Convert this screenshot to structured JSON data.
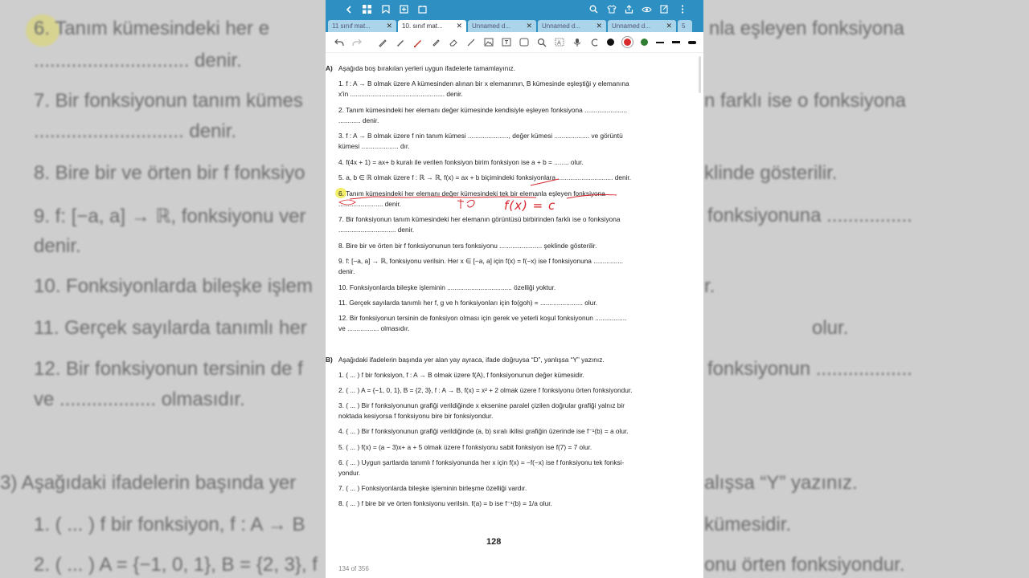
{
  "tabs": [
    {
      "label": "11 sınıf mat...",
      "active": false
    },
    {
      "label": "10. sınıf mat...",
      "active": true
    },
    {
      "label": "Unnamed d...",
      "active": false
    },
    {
      "label": "Unnamed d...",
      "active": false
    },
    {
      "label": "Unnamed d...",
      "active": false
    },
    {
      "label": "5",
      "active": false
    }
  ],
  "colors": {
    "topbar": "#2e8fc2",
    "ink": "#d6242b",
    "highlight": "#f3ee6a",
    "dot_red": "#d92c2c",
    "dot_green": "#2f7d32"
  },
  "handwriting": {
    "answer": "f(x) = c"
  },
  "sectionA": {
    "marker": "A)",
    "instruction": "Aşağıda boş bırakılan yerleri uygun ifadelerle tamamlayınız.",
    "lines": [
      "1. f : A → B olmak üzere A kümesinden alınan bir x elemanının, B kümesinde eşleştiği y elemanına",
      "x'in ................................................... denir.",
      "2. Tanım kümesindeki her elemanı değer kümesinde kendisiyle eşleyen fonksiyona .......................",
      "............ denir.",
      "3. f : A → B olmak üzere f nin tanım kümesi ......................, değer kümesi ................... ve görüntü",
      "kümesi .................... dır.",
      "4. f(4x + 1) = ax+ b kuralı ile verilen fonksiyon birim fonksiyon ise a + b = ........ olur.",
      "5. a, b ∈ ℝ olmak üzere f : ℝ → ℝ,  f(x) = ax + b biçimindeki fonksiyonlara .............................. denir.",
      "6. Tanım kümesindeki her elemanı değer kümesindeki tek bir elemanla eşleyen fonksiyona",
      "........................ denir.",
      "7. Bir fonksiyonun tanım kümesindeki her elemanın görüntüsü birbirinden farklı ise o fonksiyona",
      "............................... denir.",
      "8. Bire bir ve örten bir f fonksiyonunun ters fonksiyonu ....................... şeklinde gösterilir.",
      "9. f: [−a, a] → ℝ, fonksiyonu verilsin. Her x ∈ [−a, a] için f(x) = f(−x) ise f fonksiyonuna ................",
      "denir.",
      "10. Fonksiyonlarda bileşke işleminin ................................... özelliği yoktur.",
      "11. Gerçek sayılarda tanımlı her f, g ve h fonksiyonları için fo(goh) = ....................... olur.",
      "12. Bir fonksiyonun tersinin de fonksiyon olması için gerek ve yeterli koşul fonksiyonun .................",
      "ve ................. olmasıdır."
    ]
  },
  "sectionB": {
    "marker": "B)",
    "instruction": "Aşağıdaki ifadelerin başında yer alan yay ayraca, ifade doğruysa “D”, yanlışsa “Y” yazınız.",
    "lines": [
      "1. ( ... ) f bir fonksiyon, f : A → B olmak üzere f(A), f fonksiyonunun değer kümesidir.",
      "2. ( ... ) A = {−1, 0, 1}, B = {2, 3}, f : A → B, f(x) = x² + 2 olmak üzere f fonksiyonu örten fonksiyondur.",
      "3. ( ... ) Bir f fonksiyonunun grafiği verildiğinde x eksenine paralel çizilen doğrular grafiği yalnız bir",
      "noktada kesiyorsa f fonksiyonu bire bir fonksiyondur.",
      "4. ( ... ) Bir f fonksiyonunun grafiği verildiğinde (a, b) sıralı ikilisi grafiğin üzerinde ise f⁻¹(b) = a olur.",
      "5. ( ... ) f(x) = (a − 3)x+ a + 5 olmak üzere f fonksiyonu sabit fonksiyon ise f(7) = 7 olur.",
      "6. ( ... ) Uygun şartlarda tanımlı f fonksiyonunda her x için f(x) = −f(−x) ise f fonksiyonu tek fonksi-",
      "yondur.",
      "7. ( ... ) Fonksiyonlarda bileşke işleminin birleşme özelliği vardır.",
      "8. ( ... ) f bire bir ve örten fonksiyonu verilsin. f(a) = b ise f⁻¹(b) = 1/a olur."
    ]
  },
  "page_number": "128",
  "page_count": "134 of 356",
  "background": {
    "lines": [
      "6. Tanım kümesindeki her e",
      "............................. denir.",
      "7. Bir fonksiyonun tanım kümes",
      "............................ denir.",
      "8. Bire bir ve örten bir f fonksiyo",
      "9. f: [−a, a] → ℝ, fonksiyonu ver",
      "denir.",
      "10. Fonksiyonlarda bileşke işlem",
      "11. Gerçek sayılarda tanımlı her",
      "12. Bir fonksiyonun tersinin de f",
      "ve .................. olmasıdır.",
      "3)  Aşağıdaki ifadelerin başında yer",
      "1. ( ... ) f bir fonksiyon, f : A → B",
      "2. ( ... ) A = {−1, 0, 1}, B = {2, 3}, f"
    ],
    "right_lines": [
      "nla eşleyen fonksiyona",
      "n farklı ise o fonksiyona",
      "klinde gösterilir.",
      "fonksiyonuna ................",
      "r.",
      "olur.",
      "fonksiyonun ..................",
      "alışsa “Y” yazınız.",
      "kümesidir.",
      "onu örten fonksiyondur."
    ]
  }
}
